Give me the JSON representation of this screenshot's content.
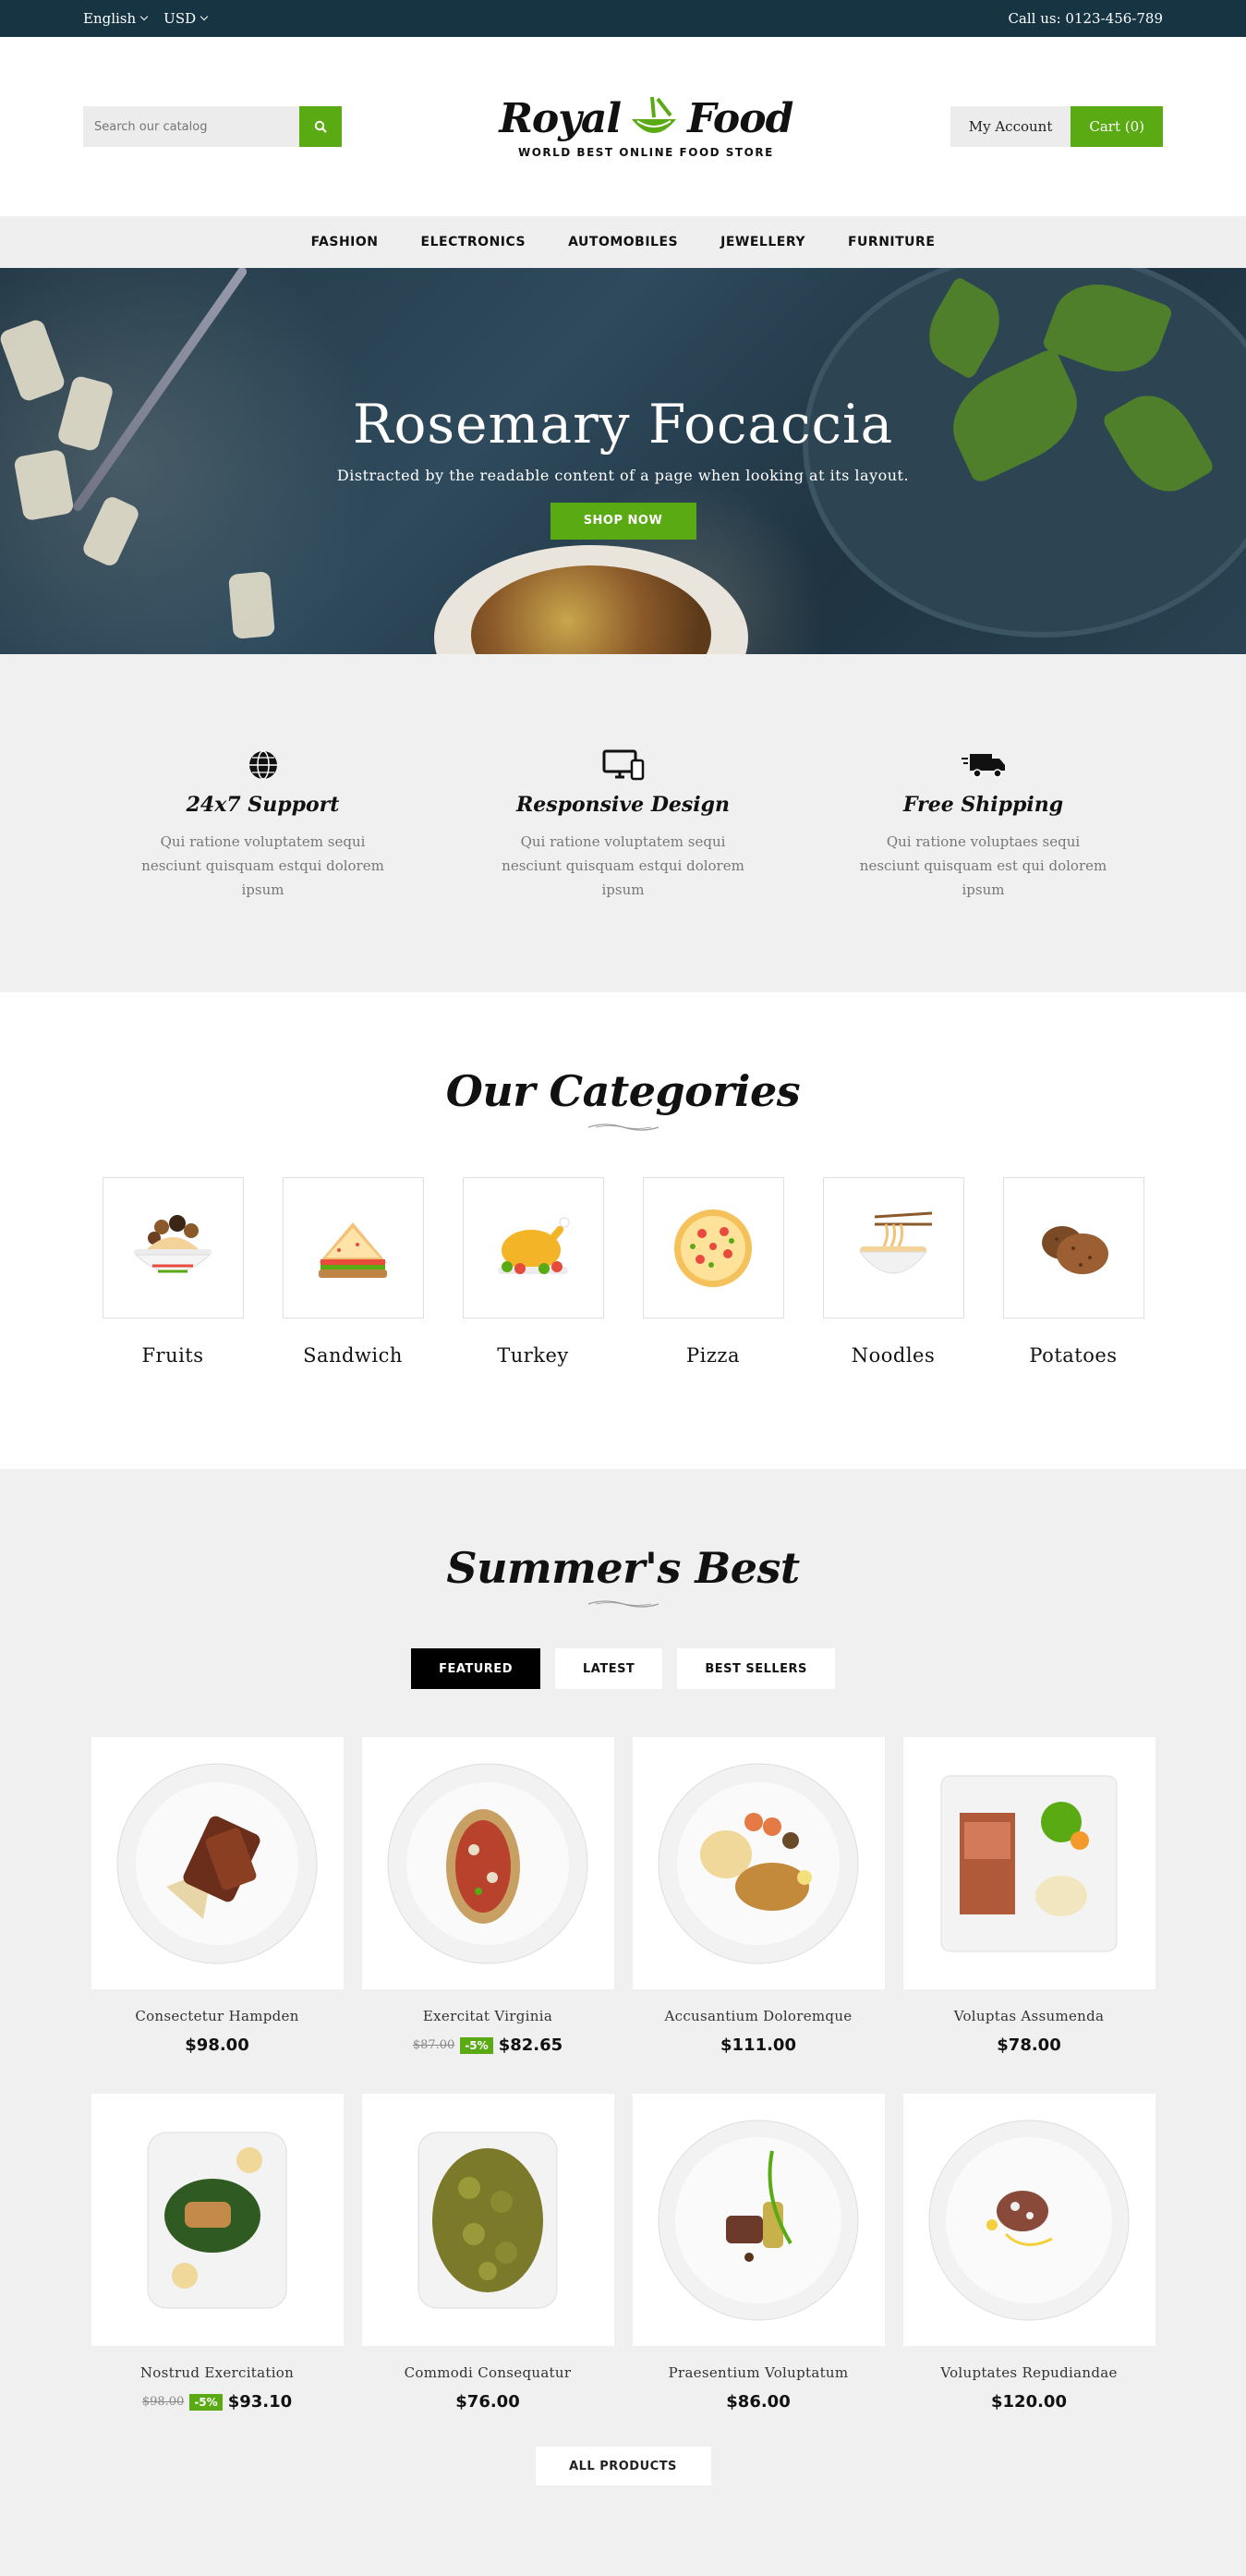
{
  "topbar": {
    "language": "English",
    "currency": "USD",
    "call": "Call us: 0123-456-789"
  },
  "header": {
    "search_placeholder": "Search our catalog",
    "logo_left": "Royal",
    "logo_right": "Food",
    "tagline": "WORLD BEST ONLINE FOOD STORE",
    "my_account": "My Account",
    "cart": "Cart (0)"
  },
  "nav": [
    "FASHION",
    "ELECTRONICS",
    "AUTOMOBILES",
    "JEWELLERY",
    "FURNITURE"
  ],
  "hero": {
    "title": "Rosemary Focaccia",
    "subtitle": "Distracted by the readable content of a page when looking at its layout.",
    "cta": "SHOP NOW"
  },
  "features": [
    {
      "icon": "globe-phone-icon",
      "title": "24x7 Support",
      "text": "Qui ratione voluptatem sequi nesciunt quisquam estqui dolorem ipsum"
    },
    {
      "icon": "devices-icon",
      "title": "Responsive Design",
      "text": "Qui ratione voluptatem sequi nesciunt quisquam estqui dolorem ipsum"
    },
    {
      "icon": "truck-icon",
      "title": "Free Shipping",
      "text": "Qui ratione voluptaes sequi nesciunt quisquam est qui dolorem ipsum"
    }
  ],
  "categories": {
    "title": "Our Categories",
    "items": [
      {
        "label": "Fruits",
        "icon": "fruit-bowl-icon"
      },
      {
        "label": "Sandwich",
        "icon": "sandwich-icon"
      },
      {
        "label": "Turkey",
        "icon": "turkey-icon"
      },
      {
        "label": "Pizza",
        "icon": "pizza-icon"
      },
      {
        "label": "Noodles",
        "icon": "noodles-icon"
      },
      {
        "label": "Potatoes",
        "icon": "potatoes-icon"
      }
    ]
  },
  "summer": {
    "title": "Summer's Best",
    "tabs": [
      "FEATURED",
      "LATEST",
      "BEST SELLERS"
    ],
    "products": [
      {
        "name": "Consectetur Hampden",
        "price": "$98.00",
        "old": "",
        "discount": ""
      },
      {
        "name": "Exercitat Virginia",
        "price": "$82.65",
        "old": "$87.00",
        "discount": "-5%"
      },
      {
        "name": "Accusantium Doloremque",
        "price": "$111.00",
        "old": "",
        "discount": ""
      },
      {
        "name": "Voluptas Assumenda",
        "price": "$78.00",
        "old": "",
        "discount": ""
      },
      {
        "name": "Nostrud Exercitation",
        "price": "$93.10",
        "old": "$98.00",
        "discount": "-5%"
      },
      {
        "name": "Commodi Consequatur",
        "price": "$76.00",
        "old": "",
        "discount": ""
      },
      {
        "name": "Praesentium Voluptatum",
        "price": "$86.00",
        "old": "",
        "discount": ""
      },
      {
        "name": "Voluptates Repudiandae",
        "price": "$120.00",
        "old": "",
        "discount": ""
      }
    ],
    "all_products": "ALL PRODUCTS"
  },
  "colors": {
    "accent": "#5aaa14",
    "topbar": "#173443",
    "section_bg": "#f0f0f0"
  }
}
